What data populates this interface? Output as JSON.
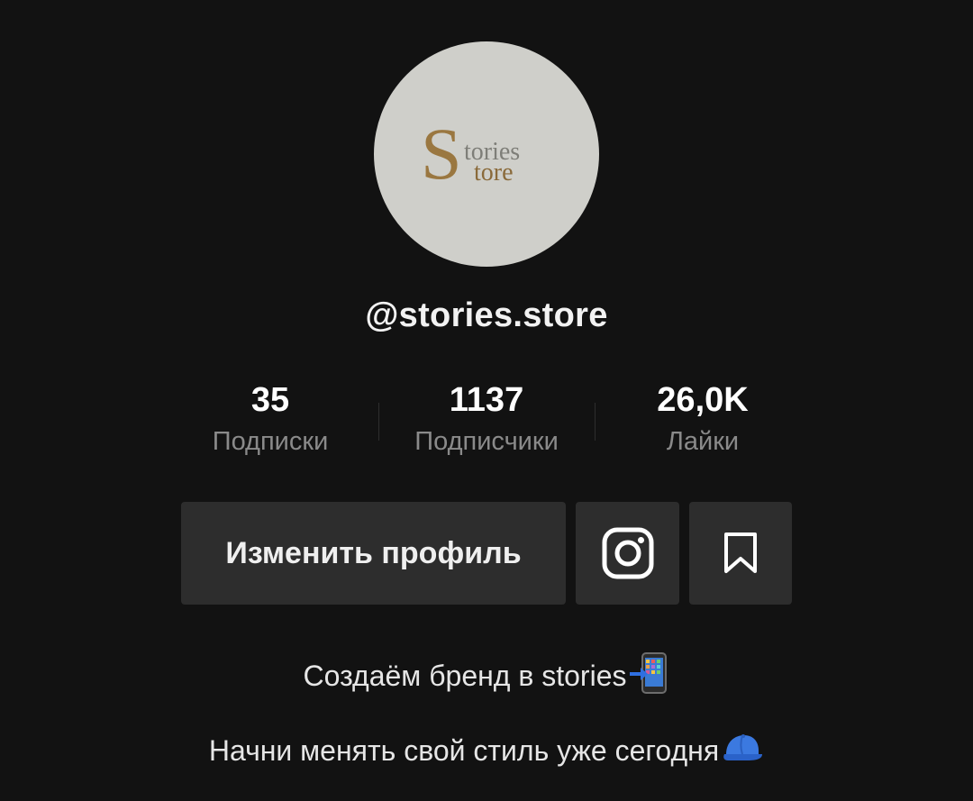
{
  "profile": {
    "username": "@stories.store",
    "avatar_logo": {
      "big_letter": "S",
      "line1": "tories",
      "line2": "tore"
    }
  },
  "stats": {
    "following": {
      "value": "35",
      "label": "Подписки"
    },
    "followers": {
      "value": "1137",
      "label": "Подписчики"
    },
    "likes": {
      "value": "26,0K",
      "label": "Лайки"
    }
  },
  "actions": {
    "edit_profile_label": "Изменить профиль",
    "instagram_icon": "instagram-icon",
    "favorites_icon": "bookmark-icon"
  },
  "bio": {
    "line1": "Создаём бренд в stories",
    "line1_emoji": "mobile-phone-arrow-emoji",
    "line2": "Начни менять свой стиль уже сегодня",
    "line2_emoji": "blue-cap-emoji"
  },
  "colors": {
    "background": "#121212",
    "button_bg": "#2d2d2d",
    "avatar_bg": "#cfcfca",
    "logo_gold": "#8a6a3a",
    "label_gray": "#8a8a8a"
  }
}
